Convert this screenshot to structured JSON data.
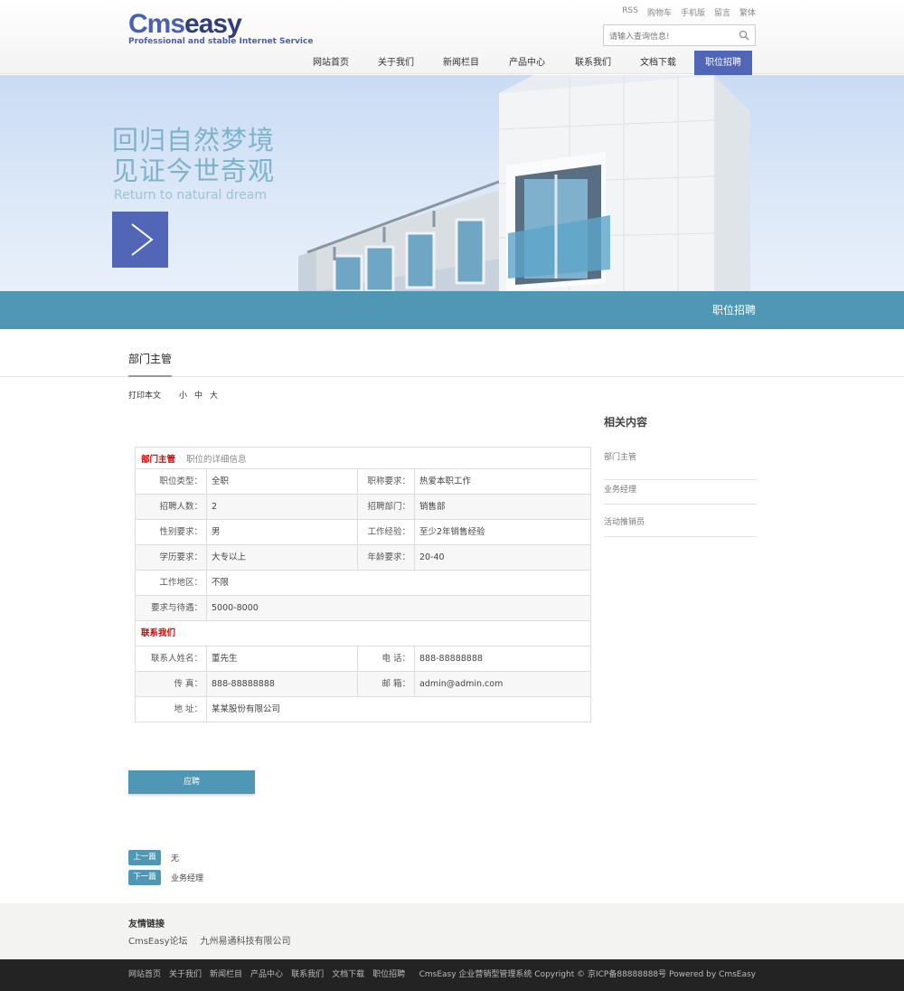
{
  "header": {
    "logo_main": "Cms",
    "logo_second": "easy",
    "tagline": "Professional and stable Internet Service",
    "top_links": [
      "RSS",
      "购物车",
      "手机版",
      "留言",
      "繁体"
    ],
    "search_placeholder": "请输入查询信息!",
    "nav": [
      "网站首页",
      "关于我们",
      "新闻栏目",
      "产品中心",
      "联系我们",
      "文档下载",
      "职位招聘"
    ],
    "active_nav": "职位招聘"
  },
  "banner": {
    "line1": "回归自然梦境",
    "line2": "见证今世奇观",
    "sub": "Return to natural dream"
  },
  "band_title": "职位招聘",
  "page_title": "部门主管",
  "tools": {
    "print": "打印本文",
    "small": "小",
    "medium": "中",
    "large": "大"
  },
  "job_table": {
    "heading": "部门主管",
    "heading_sub": "职位的详细信息",
    "rows": [
      {
        "l1": "职位类型：",
        "v1": "全职",
        "l2": "职称要求：",
        "v2": "热爱本职工作"
      },
      {
        "l1": "招聘人数：",
        "v1": "2",
        "l2": "招聘部门：",
        "v2": "销售部"
      },
      {
        "l1": "性别要求：",
        "v1": "男",
        "l2": "工作经验：",
        "v2": "至少2年销售经验"
      },
      {
        "l1": "学历要求：",
        "v1": "大专以上",
        "l2": "年龄要求：",
        "v2": "20-40"
      },
      {
        "l1": "工作地区：",
        "v1": "不限"
      },
      {
        "l1": "要求与待遇：",
        "v1": "5000-8000"
      }
    ],
    "contact_heading": "联系我们",
    "contact_rows": [
      {
        "l1": "联系人姓名：",
        "v1": "董先生",
        "l2": "电 话：",
        "v2": "888-88888888"
      },
      {
        "l1": "传 真：",
        "v1": "888-88888888",
        "l2": "邮 箱：",
        "v2": "admin@admin.com"
      },
      {
        "l1": "地 址：",
        "v1": "某某股份有限公司"
      }
    ]
  },
  "apply_button": "应聘",
  "prev": {
    "tag": "上一篇",
    "text": "无"
  },
  "next": {
    "tag": "下一篇",
    "text": "业务经理"
  },
  "sidebar": {
    "title": "相关内容",
    "items": [
      "部门主管",
      "业务经理",
      "活动推销员"
    ]
  },
  "friends": {
    "title": "友情链接",
    "links": [
      "CmsEasy论坛",
      "九州易通科技有限公司"
    ]
  },
  "footer": {
    "nav": [
      "网站首页",
      "关于我们",
      "新闻栏目",
      "产品中心",
      "联系我们",
      "文档下载",
      "职位招聘"
    ],
    "copyright": "CmsEasy 企业营销型管理系统 Copyright © 京ICP备88888888号 Powered by CmsEasy"
  },
  "colors": {
    "brand": "#5166b6",
    "accent": "#4f97b4",
    "highlight": "#d40000"
  }
}
